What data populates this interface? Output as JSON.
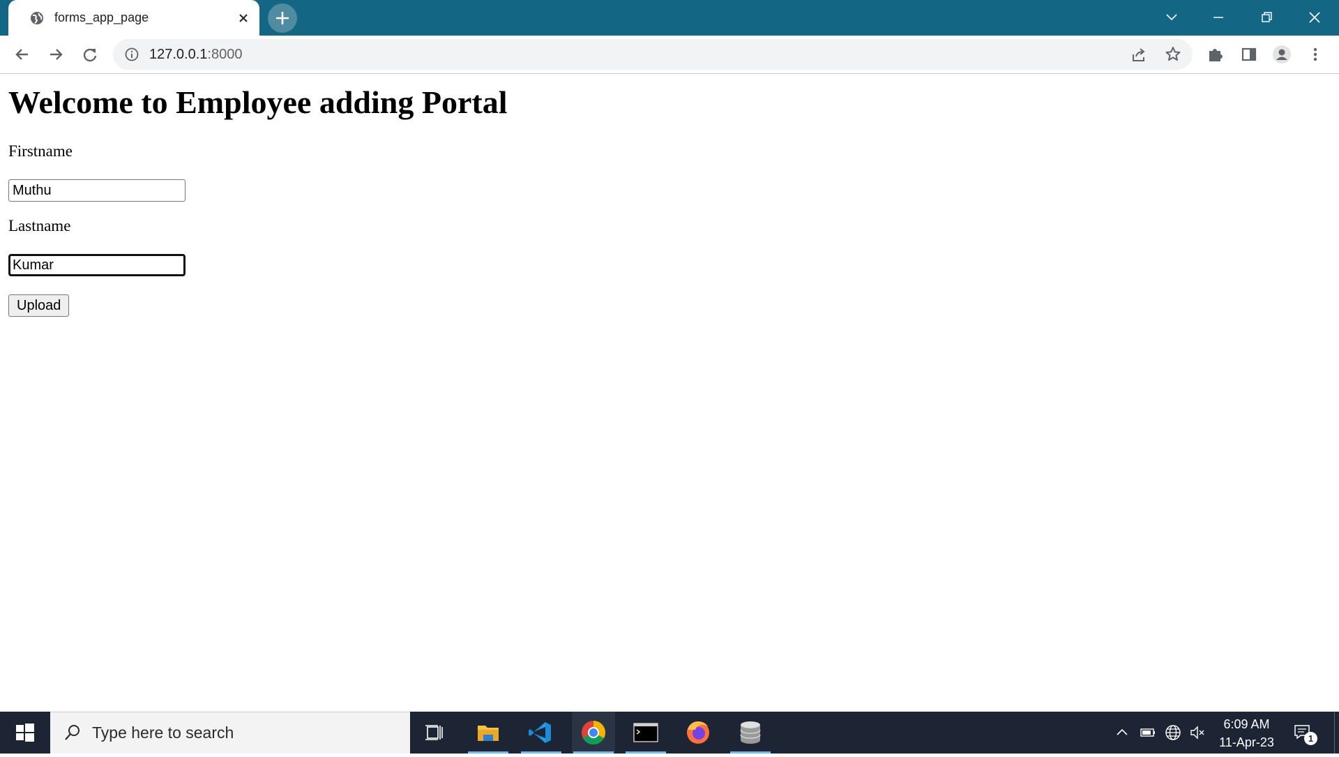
{
  "browser": {
    "tab_title": "forms_app_page",
    "url_host": "127.0.0.1",
    "url_port": ":8000"
  },
  "page": {
    "heading": "Welcome to Employee adding Portal",
    "firstname_label": "Firstname",
    "firstname_value": "Muthu",
    "lastname_label": "Lastname",
    "lastname_value": "Kumar",
    "upload_label": "Upload"
  },
  "taskbar": {
    "search_placeholder": "Type here to search",
    "time": "6:09 AM",
    "date": "11-Apr-23",
    "notification_count": "1"
  },
  "colors": {
    "tabstrip": "#146784",
    "taskbar": "#1d2535",
    "active_underline": "#76b9ed"
  }
}
